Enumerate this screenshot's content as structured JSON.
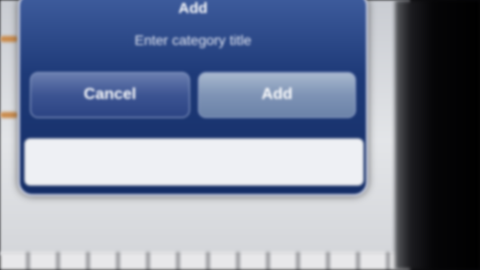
{
  "alert": {
    "title": "Add",
    "message": "Enter category title",
    "cancel_label": "Cancel",
    "confirm_label": "Add",
    "input_value": "",
    "input_placeholder": ""
  },
  "colors": {
    "alert_blue": "#1e3a78",
    "screen_bg": "#e3e5e8",
    "bezel": "#050507"
  }
}
